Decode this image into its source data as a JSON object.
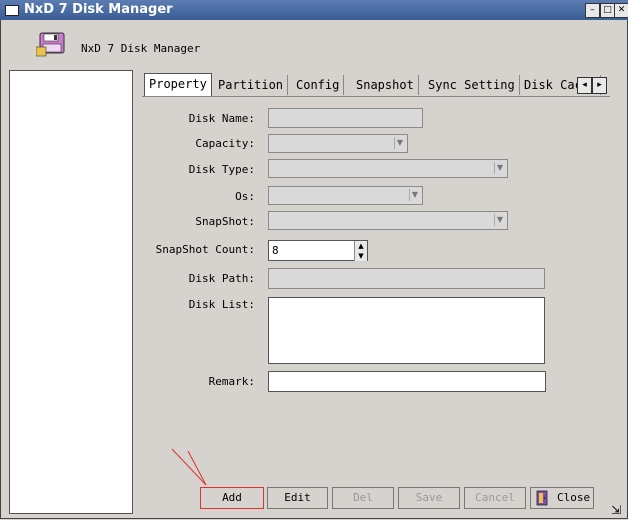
{
  "window": {
    "title": "NxD 7 Disk Manager",
    "min_symbol": "–",
    "max_symbol": "□",
    "close_symbol": "✕"
  },
  "app": {
    "title": "NxD 7 Disk Manager"
  },
  "tabs": [
    "Property",
    "Partition",
    "Config",
    "Snapshot",
    "Sync Setting",
    "Disk Cache"
  ],
  "tab_nav": {
    "prev": "◂",
    "next": "▸"
  },
  "form": {
    "disk_name": {
      "label": "Disk Name:",
      "value": ""
    },
    "capacity": {
      "label": "Capacity:",
      "value": ""
    },
    "disk_type": {
      "label": "Disk Type:",
      "value": ""
    },
    "os": {
      "label": "Os:",
      "value": ""
    },
    "snapshot": {
      "label": "SnapShot:",
      "value": ""
    },
    "snapshot_count": {
      "label": "SnapShot Count:",
      "value": "8"
    },
    "disk_path": {
      "label": "Disk Path:",
      "value": ""
    },
    "disk_list": {
      "label": "Disk List:",
      "value": ""
    },
    "remark": {
      "label": "Remark:",
      "value": ""
    }
  },
  "buttons": {
    "add": "Add",
    "edit": "Edit",
    "del": "Del",
    "save": "Save",
    "cancel": "Cancel",
    "close": "Close"
  },
  "colors": {
    "titlebar": "#3a5d96",
    "annotation": "#e03030"
  }
}
